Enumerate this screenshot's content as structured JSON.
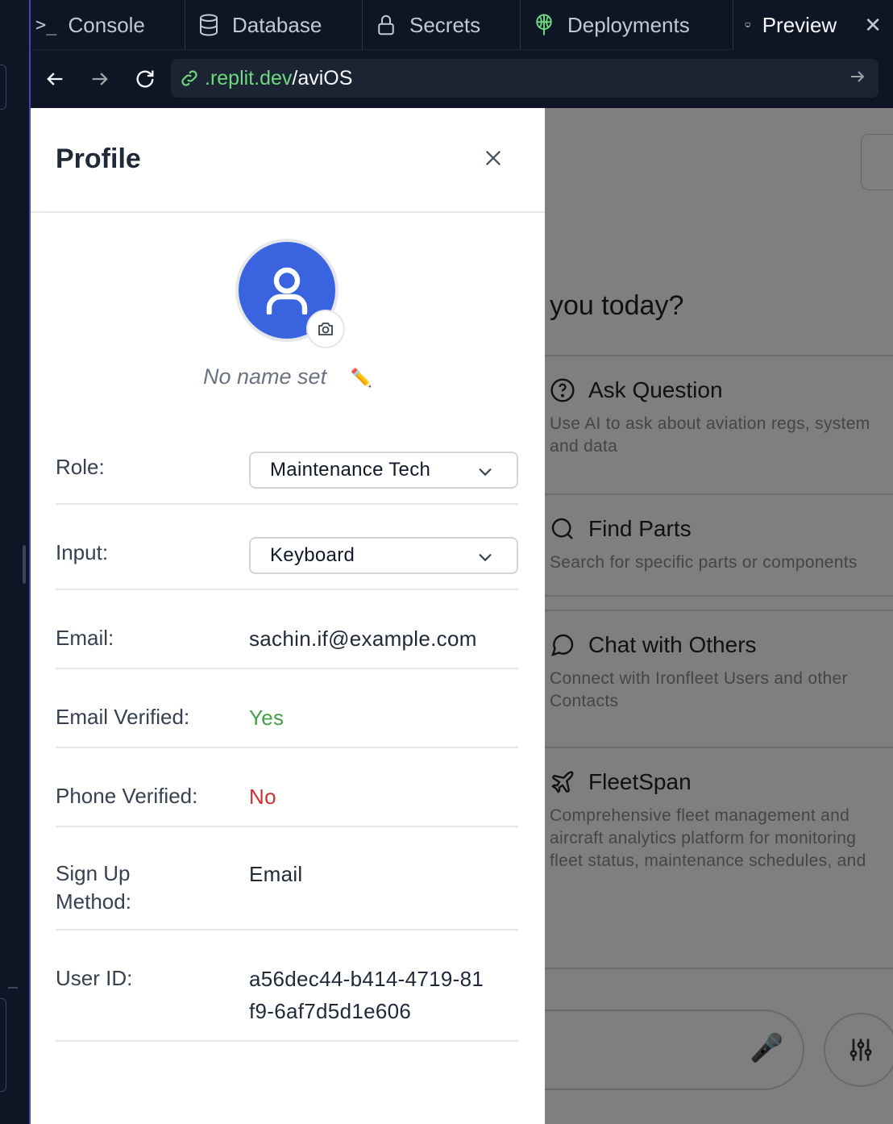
{
  "tabs": [
    {
      "label": "Console",
      "icon": "terminal-icon"
    },
    {
      "label": "Database",
      "icon": "database-icon"
    },
    {
      "label": "Secrets",
      "icon": "lock-icon"
    },
    {
      "label": "Deployments",
      "icon": "deployments-icon"
    },
    {
      "label": "Preview",
      "icon": "monitor-icon",
      "active": true
    }
  ],
  "url": {
    "domain": ".replit.dev",
    "path": "/aviOS"
  },
  "background": {
    "greeting": "you today?",
    "cards": [
      {
        "title": "Ask Question",
        "description": "Use AI to ask about aviation regs, system\nand data"
      },
      {
        "title": "Find Parts",
        "description": "Search for specific parts or components"
      },
      {
        "title": "Chat with Others",
        "description": "Connect with Ironfleet Users and other\nContacts"
      },
      {
        "title": "FleetSpan",
        "description": "Comprehensive fleet management and\naircraft analytics platform for monitoring\nfleet status, maintenance schedules, and"
      }
    ]
  },
  "profile": {
    "title": "Profile",
    "name": "No name set",
    "edit_icon": "✏️",
    "fields": {
      "role_label": "Role:",
      "role_value": "Maintenance Tech",
      "input_label": "Input:",
      "input_value": "Keyboard",
      "email_label": "Email:",
      "email_value": "sachin.if@example.com",
      "email_verified_label": "Email Verified:",
      "email_verified_value": "Yes",
      "phone_verified_label": "Phone Verified:",
      "phone_verified_value": "No",
      "signup_label_1": "Sign Up",
      "signup_label_2": "Method:",
      "signup_value": "Email",
      "userid_label": "User ID:",
      "userid_value_1": "a56dec44-b414-4719-81",
      "userid_value_2": "f9-6af7d5d1e606"
    }
  },
  "colors": {
    "avatar": "#3a63e0",
    "verified_yes": "#43a047",
    "verified_no": "#d32f2f",
    "url_domain": "#6cd97e"
  }
}
